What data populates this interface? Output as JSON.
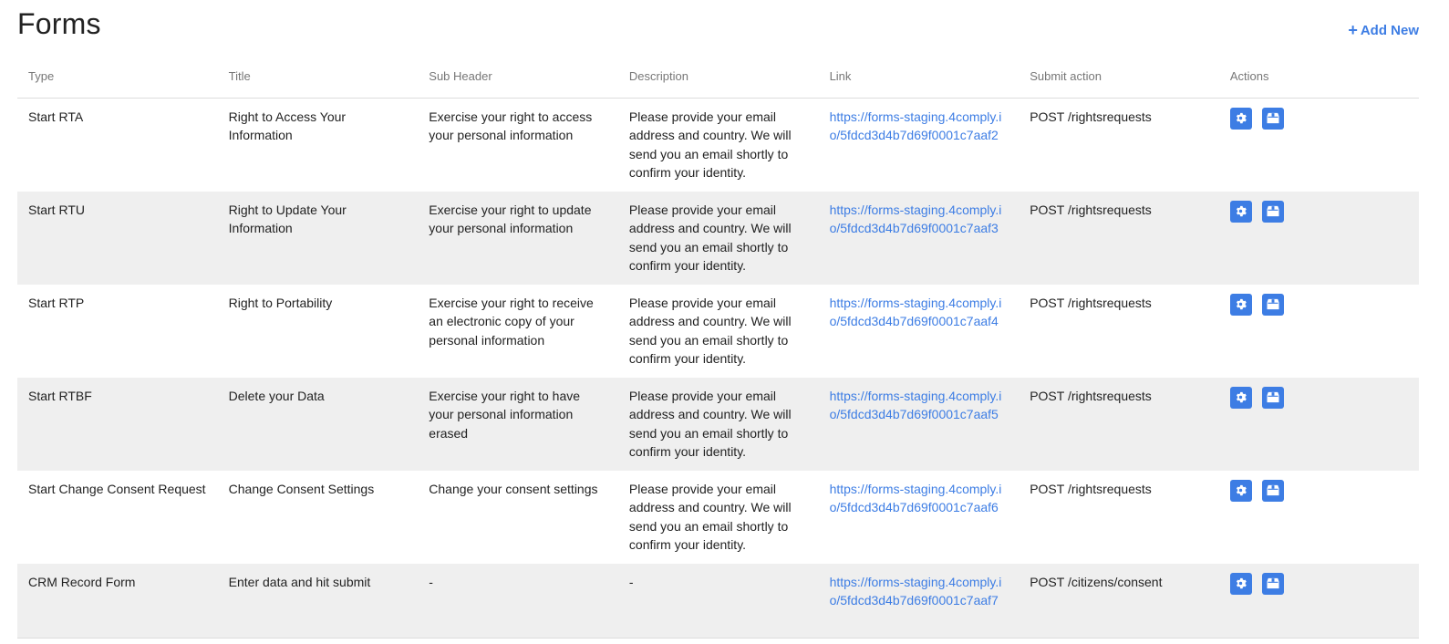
{
  "page": {
    "title": "Forms",
    "add_new_label": "Add New"
  },
  "table": {
    "headers": [
      "Type",
      "Title",
      "Sub Header",
      "Description",
      "Link",
      "Submit action",
      "Actions"
    ],
    "rows": [
      {
        "type": "Start RTA",
        "title": "Right to Access Your Information",
        "sub_header": "Exercise your right to access your personal information",
        "description": "Please provide your email address and country. We will send you an email shortly to confirm your identity.",
        "link": "https://forms-staging.4comply.io/5fdcd3d4b7d69f0001c7aaf2",
        "submit_action": "POST /rightsrequests"
      },
      {
        "type": "Start RTU",
        "title": "Right to Update Your Information",
        "sub_header": "Exercise your right to update your personal information",
        "description": "Please provide your email address and country. We will send you an email shortly to confirm your identity.",
        "link": "https://forms-staging.4comply.io/5fdcd3d4b7d69f0001c7aaf3",
        "submit_action": "POST /rightsrequests"
      },
      {
        "type": "Start RTP",
        "title": "Right to Portability",
        "sub_header": "Exercise your right to receive an electronic copy of your personal information",
        "description": "Please provide your email address and country. We will send you an email shortly to confirm your identity.",
        "link": "https://forms-staging.4comply.io/5fdcd3d4b7d69f0001c7aaf4",
        "submit_action": "POST /rightsrequests"
      },
      {
        "type": "Start RTBF",
        "title": "Delete your Data",
        "sub_header": "Exercise your right to have your personal information erased",
        "description": "Please provide your email address and country. We will send you an email shortly to confirm your identity.",
        "link": "https://forms-staging.4comply.io/5fdcd3d4b7d69f0001c7aaf5",
        "submit_action": "POST /rightsrequests"
      },
      {
        "type": "Start Change Consent Request",
        "title": "Change Consent Settings",
        "sub_header": "Change your consent settings",
        "description": "Please provide your email address and country. We will send you an email shortly to confirm your identity.",
        "link": "https://forms-staging.4comply.io/5fdcd3d4b7d69f0001c7aaf6",
        "submit_action": "POST /rightsrequests"
      },
      {
        "type": "CRM Record Form",
        "title": "Enter data and hit submit",
        "sub_header": "-",
        "description": "-",
        "link": "https://forms-staging.4comply.io/5fdcd3d4b7d69f0001c7aaf7",
        "submit_action": "POST /citizens/consent"
      }
    ]
  },
  "icons": {
    "settings": "gear-icon",
    "embed": "box-icon",
    "add": "plus-icon"
  },
  "colors": {
    "accent": "#3d7de4",
    "row_alt": "#efefef",
    "header_text": "#777777"
  }
}
